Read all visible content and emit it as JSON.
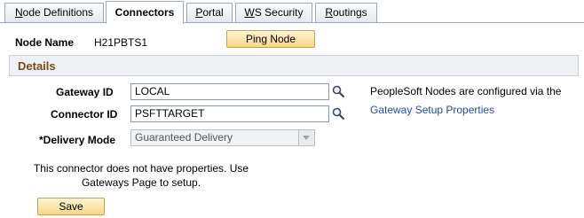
{
  "tabs": [
    {
      "label_pre": "",
      "label_u": "N",
      "label_post": "ode Definitions"
    },
    {
      "label_pre": "",
      "label_u": "",
      "label_post": "Connectors"
    },
    {
      "label_pre": "",
      "label_u": "P",
      "label_post": "ortal"
    },
    {
      "label_pre": "",
      "label_u": "W",
      "label_post": "S Security"
    },
    {
      "label_pre": "",
      "label_u": "R",
      "label_post": "outings"
    }
  ],
  "header": {
    "node_name_label": "Node Name",
    "node_name_value": "H21PBTS1",
    "ping_button": "Ping Node"
  },
  "details": {
    "title": "Details",
    "gateway_id_label": "Gateway ID",
    "gateway_id_value": "LOCAL",
    "connector_id_label": "Connector ID",
    "connector_id_value": "PSFTTARGET",
    "delivery_mode_label": "*Delivery Mode",
    "delivery_mode_value": "Guaranteed Delivery",
    "info_text": "PeopleSoft Nodes are configured via the",
    "info_link": "Gateway Setup Properties",
    "message_line1": "This connector does not have properties. Use",
    "message_line2": "Gateways Page to setup."
  },
  "footer": {
    "save_button": "Save"
  },
  "colors": {
    "section_title": "#7a4a12",
    "link": "#1f4ea3",
    "button_fill": "#f7d886"
  }
}
